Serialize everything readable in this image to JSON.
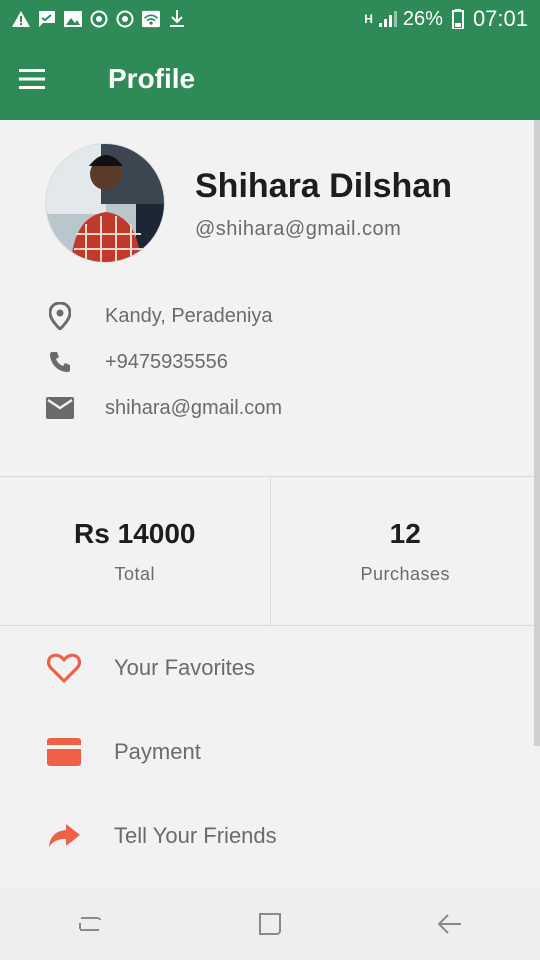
{
  "status_bar": {
    "battery": "26%",
    "time": "07:01",
    "network": "H",
    "icons": [
      "warning-icon",
      "message-icon",
      "image-icon",
      "sync-icon",
      "sync-icon",
      "wifi-icon",
      "download-icon"
    ]
  },
  "app_bar": {
    "title": "Profile",
    "menu_icon": "hamburger-menu-icon",
    "color": "#2e8b57"
  },
  "profile": {
    "name": "Shihara Dilshan",
    "handle": "@shihara@gmail.com",
    "avatar": "profile-photo"
  },
  "contact": {
    "location": "Kandy, Peradeniya",
    "phone": "+9475935556",
    "email": "shihara@gmail.com"
  },
  "stats": [
    {
      "value": "Rs 14000",
      "label": "Total"
    },
    {
      "value": "12",
      "label": "Purchases"
    }
  ],
  "menu": [
    {
      "label": "Your Favorites",
      "icon": "heart-icon"
    },
    {
      "label": "Payment",
      "icon": "credit-card-icon"
    },
    {
      "label": "Tell Your Friends",
      "icon": "share-icon"
    }
  ],
  "accent_color": "#ee6048",
  "nav": [
    "recent-apps-icon",
    "home-icon",
    "back-icon"
  ]
}
